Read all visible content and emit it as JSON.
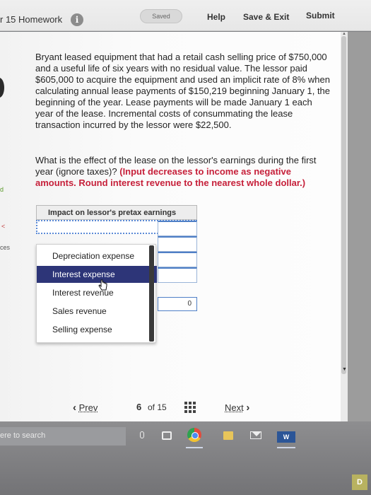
{
  "header": {
    "title": "r 15 Homework",
    "info_glyph": "i",
    "saved": "Saved",
    "help": "Help",
    "save_exit": "Save & Exit",
    "submit": "Submit"
  },
  "sidebar_fragments": {
    "a": "d",
    "b": "<",
    "c": "ces"
  },
  "question": {
    "paragraph": "Bryant leased equipment that had a retail cash selling price of $750,000 and a useful life of six years with no residual value. The lessor paid $605,000 to acquire the equipment and used an implicit rate of 8% when calculating annual lease payments of $150,219 beginning January 1, the beginning of the year. Lease payments will be made January 1 each year of the lease. Incremental costs of consummating the lease transaction incurred by the lessor were $22,500.",
    "prompt": "What is the effect of the lease on the lessor's earnings during the first year (ignore taxes)? ",
    "instruction": "(Input decreases to income as negative amounts. Round interest revenue to the nearest whole dollar.)"
  },
  "table": {
    "header": "Impact on lessor's pretax earnings",
    "select_value": "",
    "cell_value": "0"
  },
  "dropdown": {
    "options": [
      "Depreciation expense",
      "Interest expense",
      "Interest revenue",
      "Sales revenue",
      "Selling expense"
    ],
    "highlighted": "Interest expense"
  },
  "pagination": {
    "prev": "Prev",
    "prev_arrow": "‹",
    "current": "6",
    "of_total": "of 15",
    "next": "Next",
    "next_arrow": "›"
  },
  "taskbar": {
    "search_text": "ere to search",
    "word_label": "W",
    "corner": "D"
  },
  "colors": {
    "highlight": "#2d3578",
    "instruction_red": "#c6203a",
    "link_blue": "#4f7fc6"
  },
  "icons": [
    "info-icon",
    "caret-down-icon",
    "hand-cursor-icon",
    "grid-icon",
    "microphone-icon",
    "task-view-icon",
    "chrome-icon",
    "file-explorer-icon",
    "mail-icon",
    "word-icon"
  ]
}
